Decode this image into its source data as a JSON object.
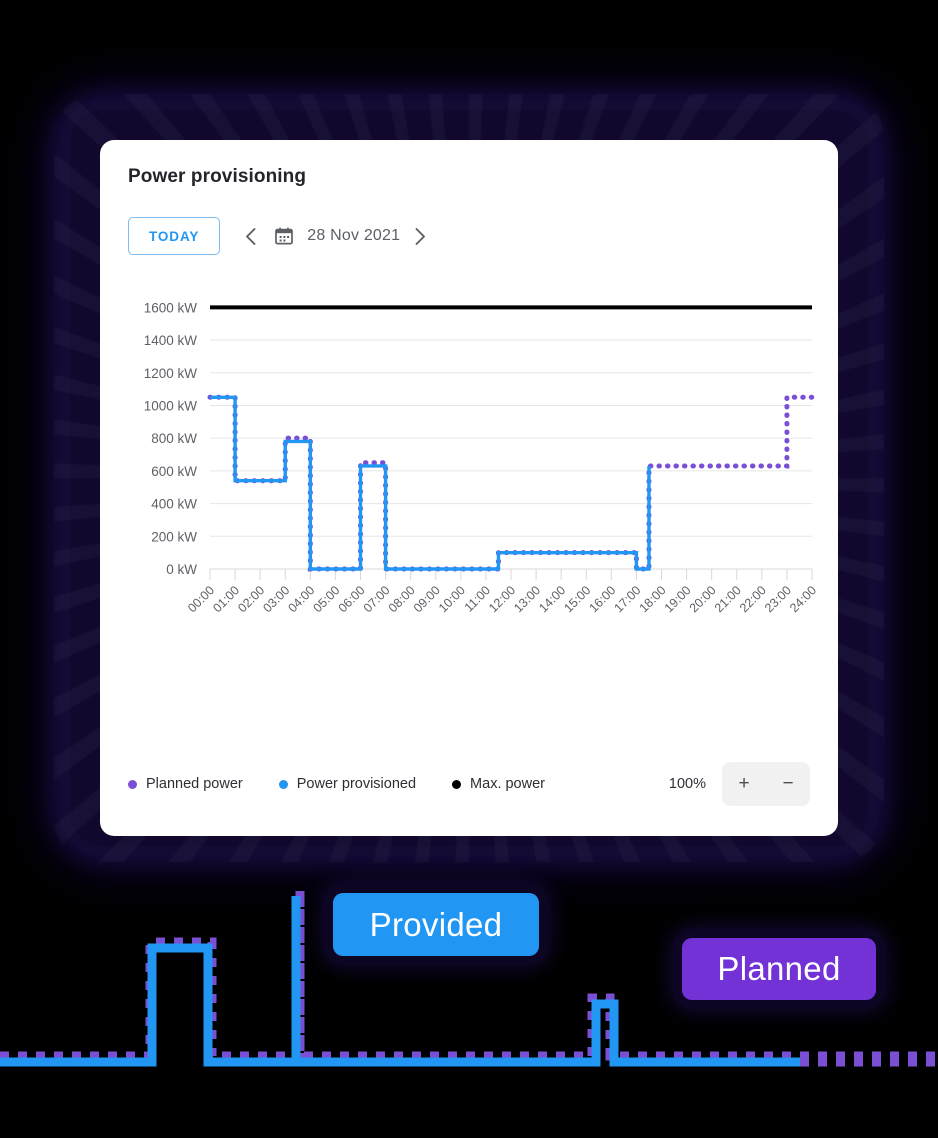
{
  "card": {
    "title": "Power provisioning",
    "toolbar": {
      "today_label": "TODAY",
      "prev_icon": "chevron-left-icon",
      "next_icon": "chevron-right-icon",
      "calendar_icon": "calendar-icon",
      "date_label": "28 Nov 2021"
    },
    "legend": [
      {
        "label": "Planned power",
        "color": "#7b4fd4"
      },
      {
        "label": "Power provisioned",
        "color": "#2196f3"
      },
      {
        "label": "Max. power",
        "color": "#000000"
      }
    ],
    "zoom": {
      "percent_label": "100%",
      "increase_label": "+",
      "decrease_label": "−"
    }
  },
  "callouts": {
    "provided": {
      "label": "Provided",
      "color": "#2196f3"
    },
    "planned": {
      "label": "Planned",
      "color": "#7232d6"
    }
  },
  "chart_data": {
    "type": "line",
    "title": "Power provisioning",
    "xlabel": "",
    "ylabel": "kW",
    "ylim": [
      0,
      1700
    ],
    "xlim": [
      0,
      24
    ],
    "grid": true,
    "legend_position": "bottom-left",
    "step_style": "post",
    "y_ticks": [
      0,
      200,
      400,
      600,
      800,
      1000,
      1200,
      1400,
      1600
    ],
    "y_tick_labels": [
      "0 kW",
      "200 kW",
      "400 kW",
      "600 kW",
      "800 kW",
      "1000 kW",
      "1200 kW",
      "1400 kW",
      "1600 kW"
    ],
    "x_ticks": [
      0,
      1,
      2,
      3,
      4,
      5,
      6,
      7,
      8,
      9,
      10,
      11,
      12,
      13,
      14,
      15,
      16,
      17,
      18,
      19,
      20,
      21,
      22,
      23,
      24
    ],
    "x_tick_labels": [
      "00:00",
      "01:00",
      "02:00",
      "03:00",
      "04:00",
      "05:00",
      "06:00",
      "07:00",
      "08:00",
      "09:00",
      "10:00",
      "11:00",
      "12:00",
      "13:00",
      "14:00",
      "15:00",
      "16:00",
      "17:00",
      "18:00",
      "19:00",
      "20:00",
      "21:00",
      "22:00",
      "23:00",
      "24:00"
    ],
    "series": [
      {
        "name": "Power provisioned",
        "color": "#2196f3",
        "style": "solid",
        "x": [
          0,
          1,
          3,
          4,
          6,
          7,
          11,
          11.5,
          17,
          17.5
        ],
        "values": [
          1050,
          540,
          780,
          0,
          630,
          0,
          0,
          100,
          0,
          630
        ],
        "ends_at": 17.5
      },
      {
        "name": "Planned power",
        "color": "#7b4fd4",
        "style": "dotted",
        "x": [
          0,
          1,
          3,
          4,
          6,
          7,
          11,
          11.5,
          17,
          17.5,
          23
        ],
        "values": [
          1050,
          540,
          800,
          0,
          650,
          0,
          0,
          100,
          0,
          630,
          1050
        ],
        "ends_at": 24
      },
      {
        "name": "Max. power",
        "color": "#000000",
        "style": "solid-thick",
        "constant": 1600
      }
    ]
  }
}
